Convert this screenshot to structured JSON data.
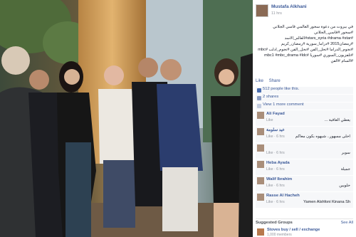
{
  "post": {
    "author": "Mustafa Alkhani",
    "time": "11 hrs",
    "caption_lines": [
      "في بيروت من دعوة سحور العالمي قاسي الجلاني",
      "#سحور #قاسي_الجلاني",
      "#stars_syria #drama #star#العالم_الاسد",
      "#رمضان2015 #دراما_سورية #رمضان_كريم",
      "#نجوم_الدراما #نحل_الفن #نحل_الفن #نجوم_ادلب #mbc",
      "#تلفزيون_السوري #سوريا #mbc1 #mbc_drama #ldc #السام #الفن"
    ],
    "actions": [
      "Like",
      "Share"
    ],
    "likes_text": "512 people like this.",
    "shares_text": "2 shares",
    "view_more_text": "View 1 more comment"
  },
  "comments": [
    {
      "name": "Ali Fayad",
      "text": "يعطي العافية ...",
      "meta": "Like"
    },
    {
      "name": "عيد سلومة",
      "text": "احلى مسهور.. شبهوه بكون معاكم",
      "meta": "Like · 6 hrs"
    },
    {
      "name": "",
      "text": "سوبر",
      "meta": "Like · 6 hrs"
    },
    {
      "name": "Heba Ayada",
      "text": "جميلة",
      "meta": "Like · 6 hrs"
    },
    {
      "name": "Walif Ibrahim",
      "text": "حلويين",
      "meta": "Like · 6 hrs"
    },
    {
      "name": "Rasse Al Hacheh",
      "text": "Yamen Alshfoni Kinana Sh",
      "meta": "Like · 6 hrs"
    }
  ],
  "suggested": {
    "title": "Suggested Groups",
    "see_all": "See All",
    "group_name": "Stoves buy / sell / exchange",
    "group_count": "1,000 members"
  },
  "colors": {
    "link": "#3b5998",
    "like_icon": "#4a6eb0",
    "share_icon": "#8b9dc3"
  }
}
